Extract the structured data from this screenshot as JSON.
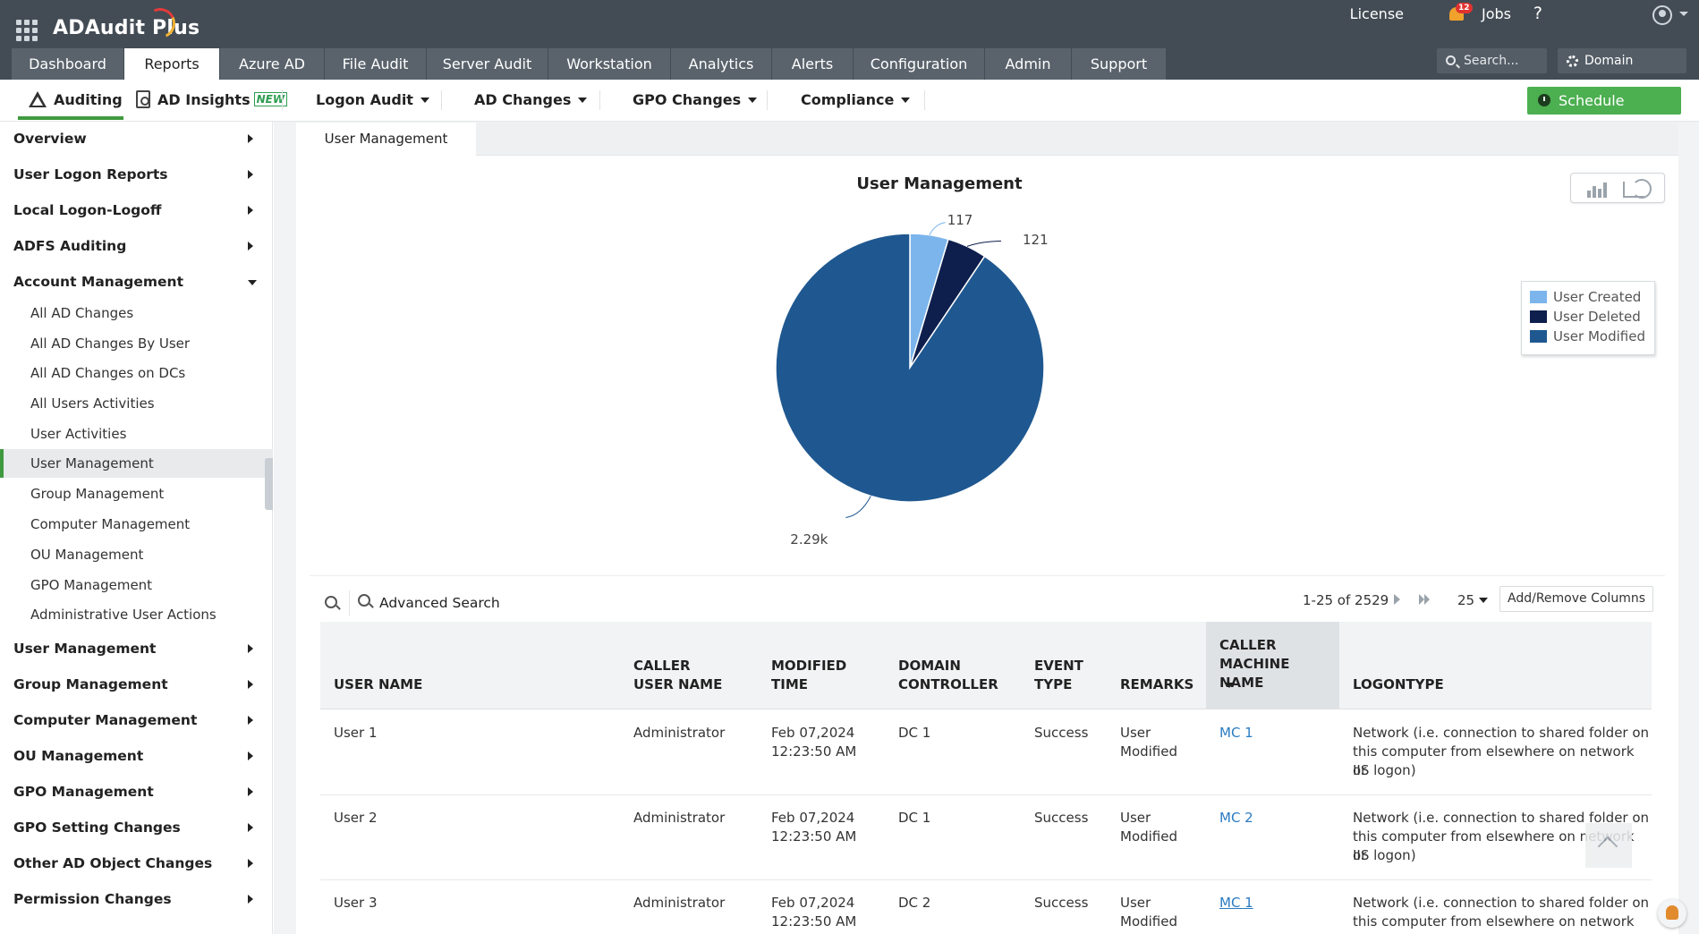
{
  "app": {
    "title": "ADAudit Plus",
    "brand_colors": {
      "header": "#434c55",
      "accent_green": "#4caf50"
    }
  },
  "header": {
    "license": "License",
    "notifications": "12",
    "jobs": "Jobs",
    "help": "?",
    "search_placeholder": "Search...",
    "domain_settings": "Domain Settings"
  },
  "nav_tabs": [
    {
      "label": "Dashboard"
    },
    {
      "label": "Reports"
    },
    {
      "label": "Azure AD"
    },
    {
      "label": "File Audit"
    },
    {
      "label": "Server Audit"
    },
    {
      "label": "Workstation"
    },
    {
      "label": "Analytics"
    },
    {
      "label": "Alerts"
    },
    {
      "label": "Configuration"
    },
    {
      "label": "Admin"
    },
    {
      "label": "Support"
    }
  ],
  "subnav": {
    "auditing": "Auditing",
    "ad_insights": "AD Insights",
    "new_badge": "NEW",
    "logon_audit": "Logon Audit",
    "ad_changes": "AD Changes",
    "gpo_changes": "GPO Changes",
    "compliance": "Compliance",
    "schedule_reports": "Schedule Reports"
  },
  "sidebar": {
    "items": [
      {
        "label": "Overview"
      },
      {
        "label": "User Logon Reports"
      },
      {
        "label": "Local Logon-Logoff"
      },
      {
        "label": "ADFS Auditing"
      },
      {
        "label": "Account Management"
      },
      {
        "label": "User Management"
      },
      {
        "label": "Group Management"
      },
      {
        "label": "Computer Management"
      },
      {
        "label": "OU Management"
      },
      {
        "label": "GPO Management"
      },
      {
        "label": "GPO Setting Changes"
      },
      {
        "label": "Other AD Object Changes"
      },
      {
        "label": "Permission Changes"
      }
    ],
    "sub_items": [
      {
        "label": "All AD Changes"
      },
      {
        "label": "All AD Changes By User"
      },
      {
        "label": "All AD Changes on DCs"
      },
      {
        "label": "All Users Activities"
      },
      {
        "label": "User Activities"
      },
      {
        "label": "User Management"
      },
      {
        "label": "Group Management"
      },
      {
        "label": "Computer Management"
      },
      {
        "label": "OU Management"
      },
      {
        "label": "GPO Management"
      },
      {
        "label": "Administrative User Actions"
      }
    ]
  },
  "report": {
    "tab_label": "User Management"
  },
  "chart_data": {
    "type": "pie",
    "title": "User Management",
    "series": [
      {
        "name": "User Created",
        "value": 117,
        "label": "117",
        "color": "#7cb5ec"
      },
      {
        "name": "User Deleted",
        "value": 121,
        "label": "121",
        "color": "#0e1f4d"
      },
      {
        "name": "User Modified",
        "value": 2291,
        "label": "2.29k",
        "color": "#1f5890"
      }
    ],
    "legend_position": "right"
  },
  "table": {
    "advanced_search": "Advanced Search",
    "pager": "1-25 of 2529",
    "page_size": "25",
    "add_remove_columns": "Add/Remove Columns",
    "headers": {
      "user_name": "USER NAME",
      "caller_user_name": "CALLER USER NAME",
      "modified_time": "MODIFIED TIME",
      "domain_controller": "DOMAIN CONTROLLER",
      "event_type": "EVENT TYPE",
      "remarks": "REMARKS",
      "caller_machine_name": "CALLER MACHINE NAME",
      "logontype": "LOGONTYPE"
    },
    "rows": [
      {
        "user": "User 1",
        "caller": "Administrator",
        "time1": "Feb 07,2024",
        "time2": "12:23:50 AM",
        "dc": "DC 1",
        "event": "Success",
        "remarks1": "User",
        "remarks2": "Modified",
        "machine": "MC 1",
        "logon1": "Network (i.e. connection to shared folder on",
        "logon2": "this computer from elsewhere on network or",
        "logon3": "IIS logon)"
      },
      {
        "user": "User 2",
        "caller": "Administrator",
        "time1": "Feb 07,2024",
        "time2": "12:23:50 AM",
        "dc": "DC 1",
        "event": "Success",
        "remarks1": "User",
        "remarks2": "Modified",
        "machine": "MC 2",
        "logon1": "Network (i.e. connection to shared folder on",
        "logon2": "this computer from elsewhere on network or",
        "logon3": "IIS logon)"
      },
      {
        "user": "User 3",
        "caller": "Administrator",
        "time1": "Feb 07,2024",
        "time2": "12:23:50 AM",
        "dc": "DC 2",
        "event": "Success",
        "remarks1": "User",
        "remarks2": "Modified",
        "machine": "MC 1",
        "logon1": "Network (i.e. connection to shared folder on",
        "logon2": "this computer from elsewhere on network or",
        "logon3": ""
      }
    ]
  }
}
